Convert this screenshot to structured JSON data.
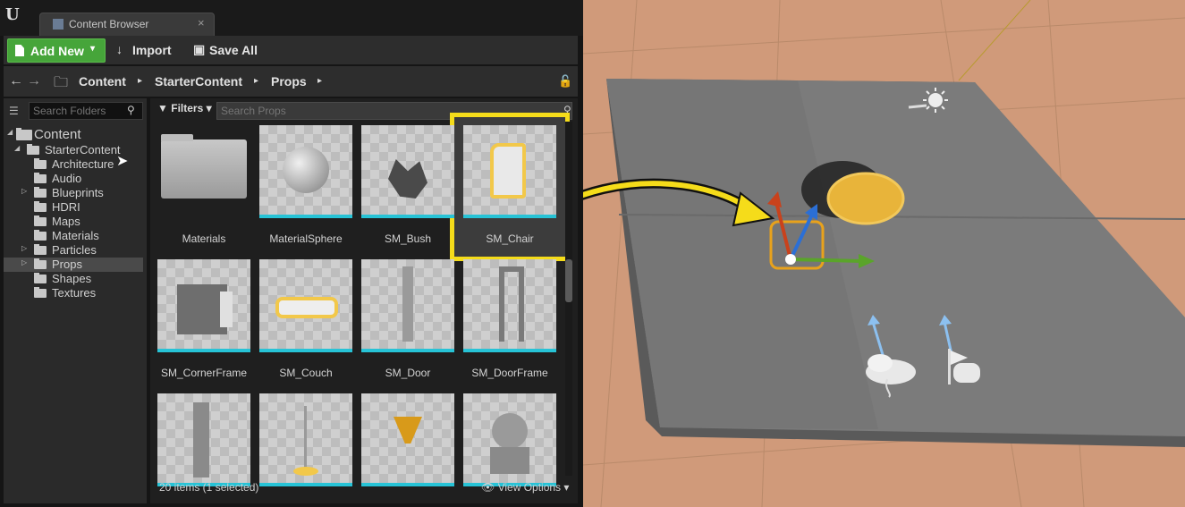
{
  "window": {
    "tab_label": "Content Browser",
    "tab_close": "×",
    "logo_glyph": "U"
  },
  "toolbar": {
    "add_new": "Add New",
    "add_new_caret": "▾",
    "import": "Import",
    "save_all": "Save All",
    "import_icon": "↓",
    "save_icon": "▣"
  },
  "nav": {
    "back": "←",
    "forward": "→",
    "breadcrumbs": [
      "Content",
      "StarterContent",
      "Props"
    ],
    "separator": "▸",
    "folder_icon": "🗀",
    "lock_icon": "🔓"
  },
  "tree": {
    "search_placeholder": "Search Folders",
    "root": "Content",
    "items": [
      {
        "label": "StarterContent",
        "expander": "◢"
      },
      {
        "label": "Architecture",
        "expander": ""
      },
      {
        "label": "Audio",
        "expander": ""
      },
      {
        "label": "Blueprints",
        "expander": "▷"
      },
      {
        "label": "HDRI",
        "expander": ""
      },
      {
        "label": "Maps",
        "expander": ""
      },
      {
        "label": "Materials",
        "expander": ""
      },
      {
        "label": "Particles",
        "expander": "▷"
      },
      {
        "label": "Props",
        "expander": "▷"
      },
      {
        "label": "Shapes",
        "expander": ""
      },
      {
        "label": "Textures",
        "expander": ""
      }
    ]
  },
  "assets": {
    "filters_label": "Filters",
    "filters_caret": "▾",
    "search_placeholder": "Search Props",
    "status": "20 items (1 selected)",
    "view_options": "View Options",
    "view_options_caret": "▾",
    "eye_icon": "👁",
    "tiles": [
      {
        "label": "Materials",
        "kind": "folder"
      },
      {
        "label": "MaterialSphere",
        "kind": "sphere"
      },
      {
        "label": "SM_Bush",
        "kind": "bush"
      },
      {
        "label": "SM_Chair",
        "kind": "chair",
        "selected": true
      },
      {
        "label": "SM_CornerFrame",
        "kind": "cornerframe"
      },
      {
        "label": "SM_Couch",
        "kind": "couch"
      },
      {
        "label": "SM_Door",
        "kind": "door"
      },
      {
        "label": "SM_DoorFrame",
        "kind": "doorframe"
      },
      {
        "label": "",
        "kind": "pillar"
      },
      {
        "label": "",
        "kind": "lamp"
      },
      {
        "label": "",
        "kind": "bowl"
      },
      {
        "label": "",
        "kind": "statue"
      }
    ]
  },
  "colors": {
    "accent_green": "#46a53a",
    "highlight_yellow": "#f5dc1a",
    "thumb_underline": "#27c3d6",
    "floor": "#7a7a7a",
    "ground": "#d09a7a"
  }
}
